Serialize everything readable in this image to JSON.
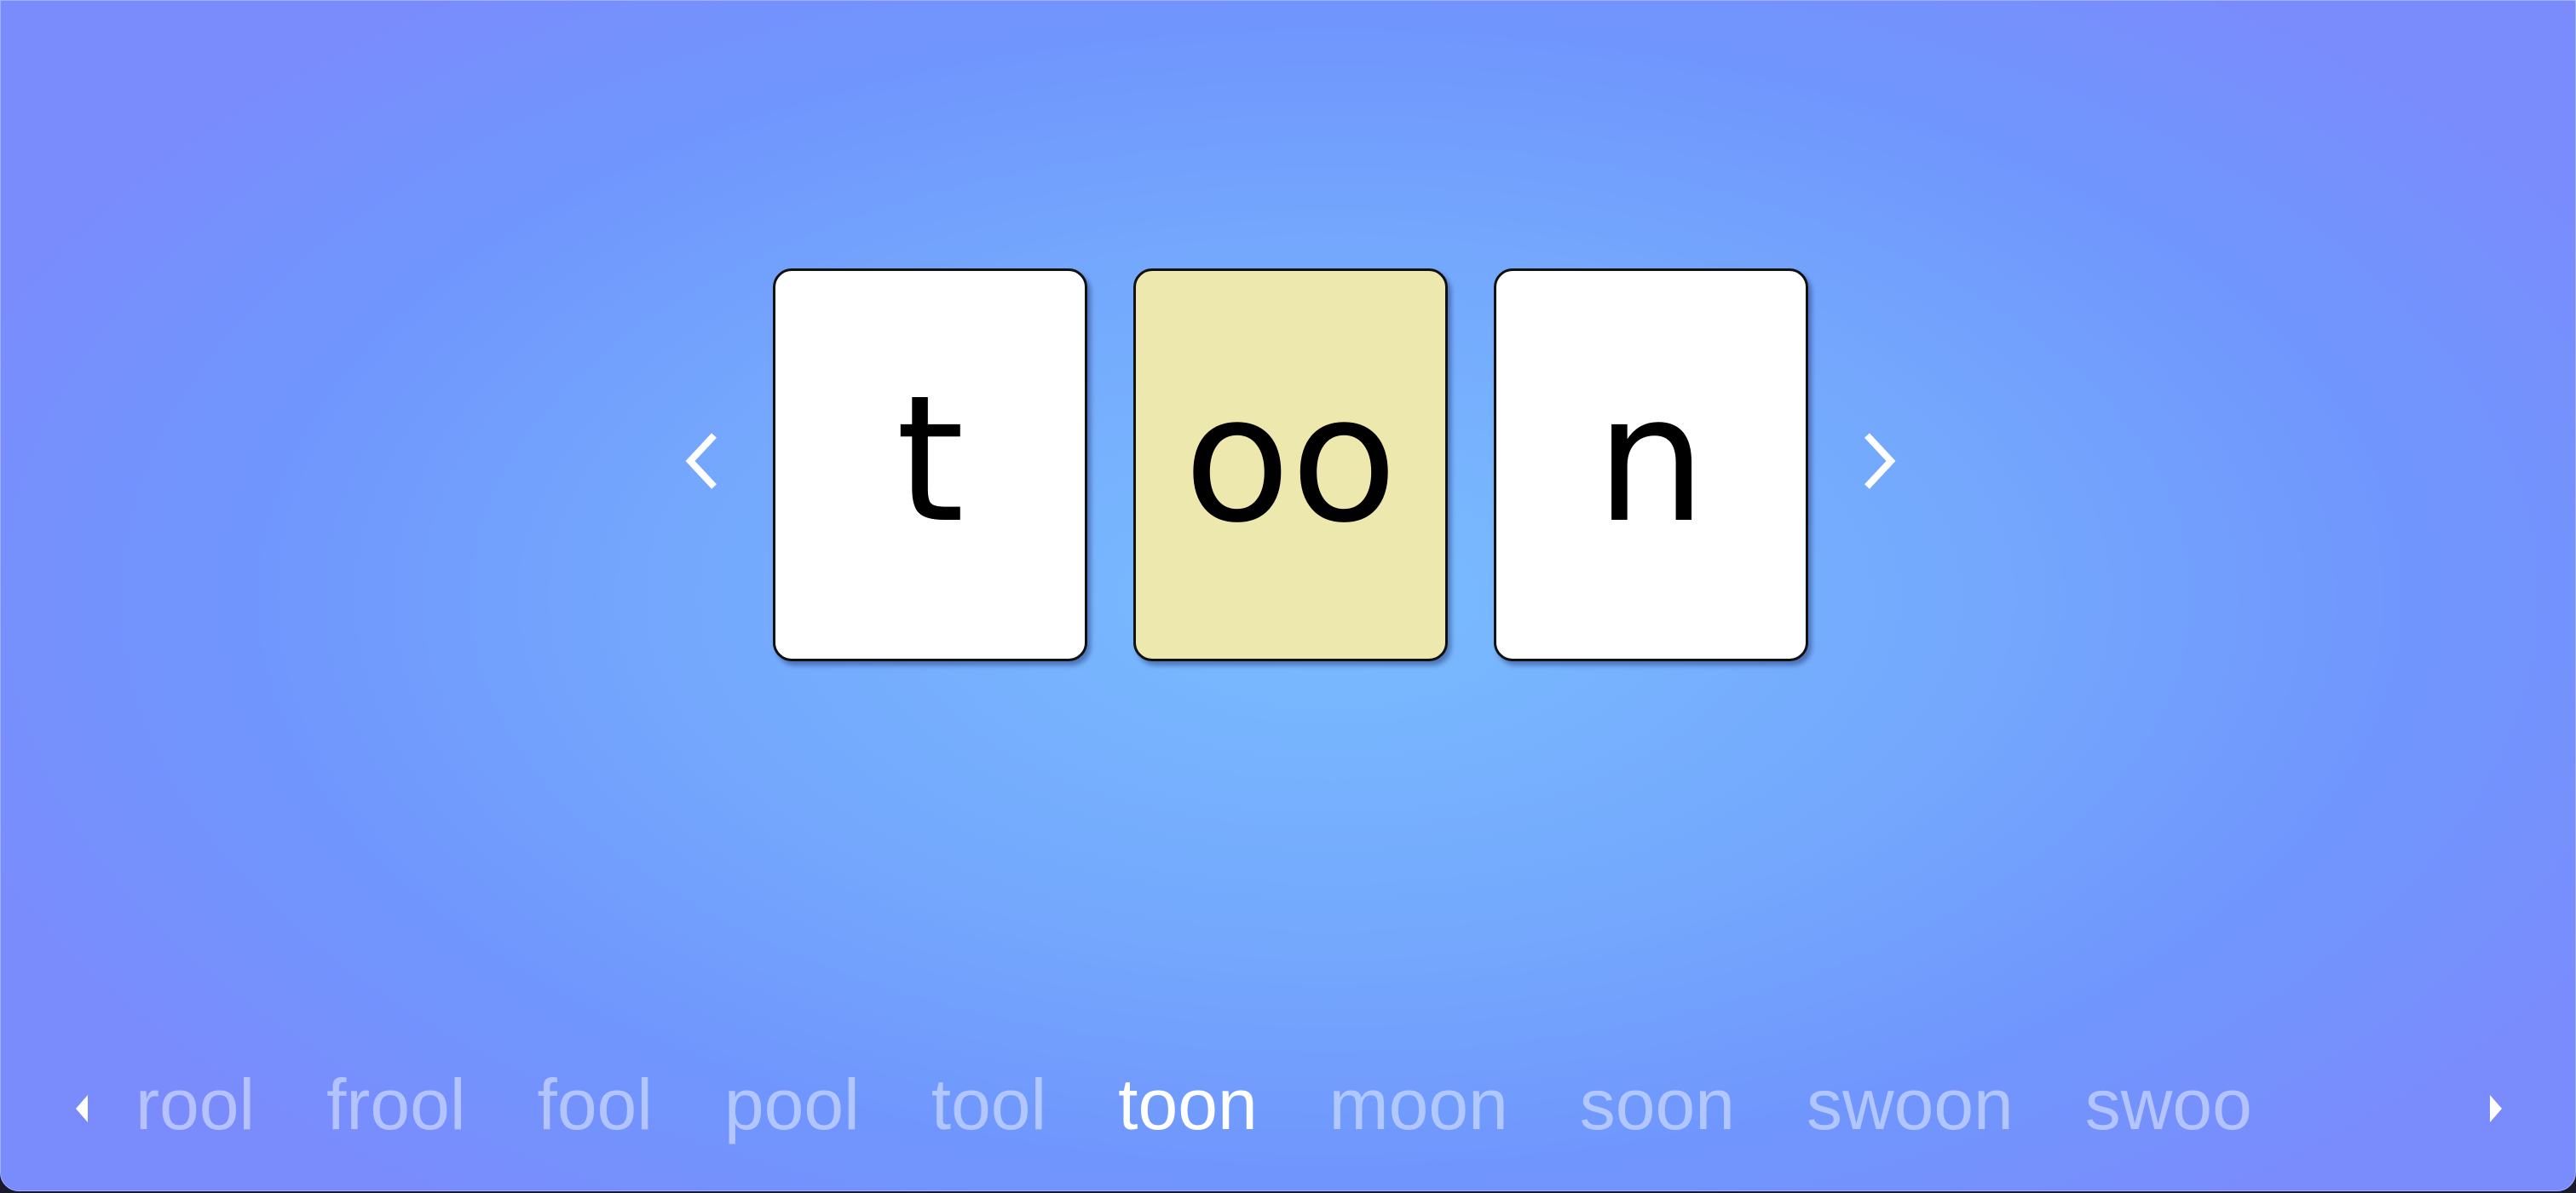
{
  "cards": [
    {
      "letters": "t",
      "highlighted": false
    },
    {
      "letters": "oo",
      "highlighted": true
    },
    {
      "letters": "n",
      "highlighted": false
    }
  ],
  "nav": {
    "prev_icon": "chevron-left-icon",
    "next_icon": "chevron-right-icon"
  },
  "word_list": {
    "words": [
      "rool",
      "frool",
      "fool",
      "pool",
      "tool",
      "toon",
      "moon",
      "soon",
      "swoon",
      "swoo"
    ],
    "active_index": 5,
    "prev_icon": "triangle-left-icon",
    "next_icon": "triangle-right-icon"
  },
  "colors": {
    "highlight_card": "#ede8ae",
    "background_center": "#79bcfe",
    "background_edge": "#7096fd",
    "active_word": "#ffffff"
  }
}
